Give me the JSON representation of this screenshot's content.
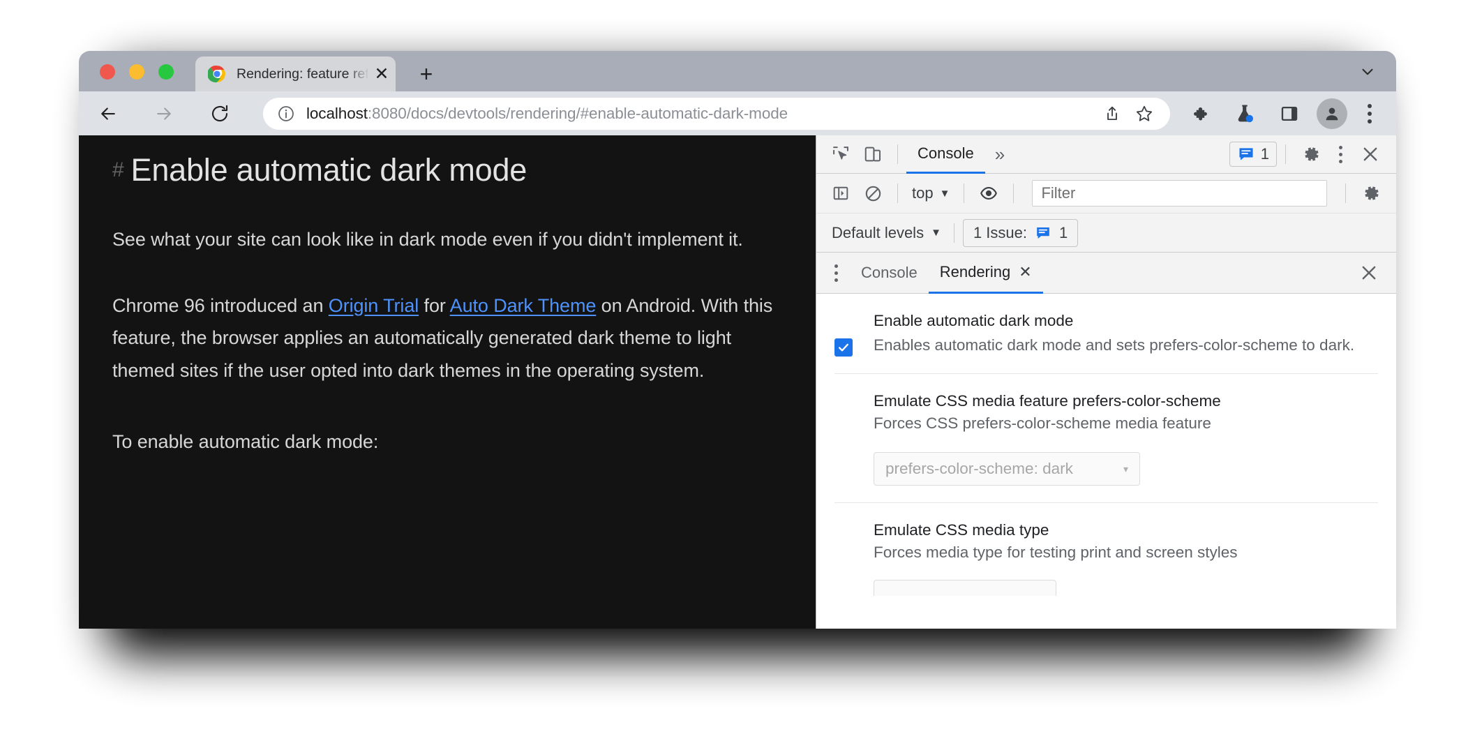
{
  "window": {
    "titlebar": {
      "traffic_lights": [
        "close",
        "minimize",
        "zoom"
      ],
      "tab": {
        "favicon": "chrome-logo-icon",
        "title": "Rendering: feature reference - ",
        "close_label": "✕"
      },
      "new_tab_label": "+",
      "tab_list_chevron": "chevron-down-icon"
    },
    "toolbar": {
      "back": "back-arrow-icon",
      "forward": "forward-arrow-icon",
      "reload": "reload-icon",
      "site_info": "info-circle-icon",
      "url_host": "localhost",
      "url_rest": ":8080/docs/devtools/rendering/#enable-automatic-dark-mode",
      "share": "share-icon",
      "bookmark": "star-icon",
      "extensions": "puzzle-piece-icon",
      "experiments": "flask-icon",
      "side_panel": "side-panel-icon",
      "profile": "person-avatar-icon",
      "menu": "three-dot-menu-icon"
    }
  },
  "page": {
    "heading_anchor": "#",
    "heading": "Enable automatic dark mode",
    "paragraph_1": "See what your site can look like in dark mode even if you didn't implement it.",
    "paragraph_2": {
      "before_link1": "Chrome 96 introduced an ",
      "link1": "Origin Trial",
      "between": " for ",
      "link2": "Auto Dark Theme",
      "after": " on Android. With this feature, the browser applies an automatically generated dark theme to light themed sites if the user opted into dark themes in the operating system."
    },
    "paragraph_3": "To enable automatic dark mode:"
  },
  "devtools": {
    "main_tabbar": {
      "inspect_icon": "inspect-element-icon",
      "device_icon": "device-toolbar-icon",
      "tabs": [
        {
          "label": "Console",
          "active": true
        }
      ],
      "more_tabs_label": "»",
      "issues_count": "1",
      "issues_icon": "issue-message-icon",
      "settings_icon": "gear-icon",
      "menu_icon": "three-dot-menu-icon",
      "close_icon": "close-icon"
    },
    "console_toolbar": {
      "sidebar_icon": "console-sidebar-icon",
      "clear_icon": "clear-console-icon",
      "context_value": "top",
      "context_caret": "▼",
      "eye_icon": "live-expression-eye-icon",
      "filter_placeholder": "Filter",
      "filter_value": "",
      "settings_icon": "gear-icon"
    },
    "levels_bar": {
      "levels_value": "Default levels",
      "levels_caret": "▼",
      "issue_label": "1 Issue:",
      "issue_icon": "issue-message-icon",
      "issue_count": "1"
    },
    "drawer_tabbar": {
      "menu_icon": "three-dot-menu-icon",
      "tabs": [
        {
          "label": "Console",
          "active": false,
          "closable": false
        },
        {
          "label": "Rendering",
          "active": true,
          "closable": true,
          "close_label": "✕"
        }
      ],
      "close_icon": "close-icon"
    },
    "rendering_settings": [
      {
        "title": "Enable automatic dark mode",
        "description": "Enables automatic dark mode and sets prefers-color-scheme to dark.",
        "control": "checkbox",
        "checked": true
      },
      {
        "title": "Emulate CSS media feature prefers-color-scheme",
        "description": "Forces CSS prefers-color-scheme media feature",
        "control": "select",
        "select_value": "prefers-color-scheme: dark",
        "select_caret": "▾",
        "disabled": true
      },
      {
        "title": "Emulate CSS media type",
        "description": "Forces media type for testing print and screen styles",
        "control": "select-partial"
      }
    ]
  },
  "colors": {
    "accent_blue": "#1a73e8",
    "link_blue": "#4e92fb",
    "titlebar": "#a8adb8",
    "toolbar": "#dee1e6",
    "page_bg": "#131313",
    "devtools_bg": "#f3f3f3",
    "checkbox": "#1a73e8"
  }
}
